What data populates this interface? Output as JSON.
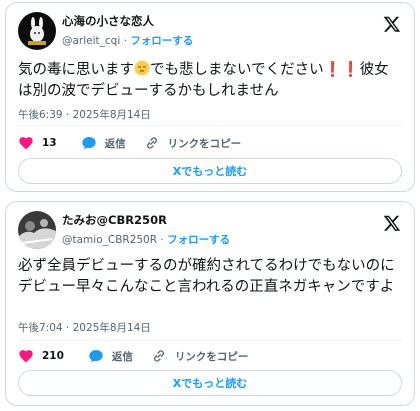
{
  "colors": {
    "accent": "#1d9bf0",
    "like": "#f91880",
    "muted": "#536471",
    "text": "#0f1419",
    "border": "#cfd9de"
  },
  "posts": [
    {
      "name": "心海の小さな恋人",
      "handle": "@arleit_cqi",
      "separator": "·",
      "follow_label": "フォローする",
      "text_before": "気の毒に思います",
      "text_emoji": "pensive-face-emoji",
      "text_middle": "でも悲しまないでください",
      "text_excl": "❗❗",
      "text_after": "彼女は別の波でデビューするかもしれません",
      "time": "午後6:39 · 2025年8月14日",
      "likes": "13",
      "reply_label": "返信",
      "copy_label": "リンクをコピー",
      "read_more": "Xでもっと読む"
    },
    {
      "name": "たみお@CBR250R",
      "handle": "@tamio_CBR250R",
      "separator": "·",
      "follow_label": "フォローする",
      "text": "必ず全員デビューするのが確約されてるわけでもないのにデビュー早々こんなこと言われるの正直ネガキャンですよ",
      "time": "午後7:04 · 2025年8月14日",
      "likes": "210",
      "reply_label": "返信",
      "copy_label": "リンクをコピー",
      "read_more": "Xでもっと読む"
    }
  ]
}
